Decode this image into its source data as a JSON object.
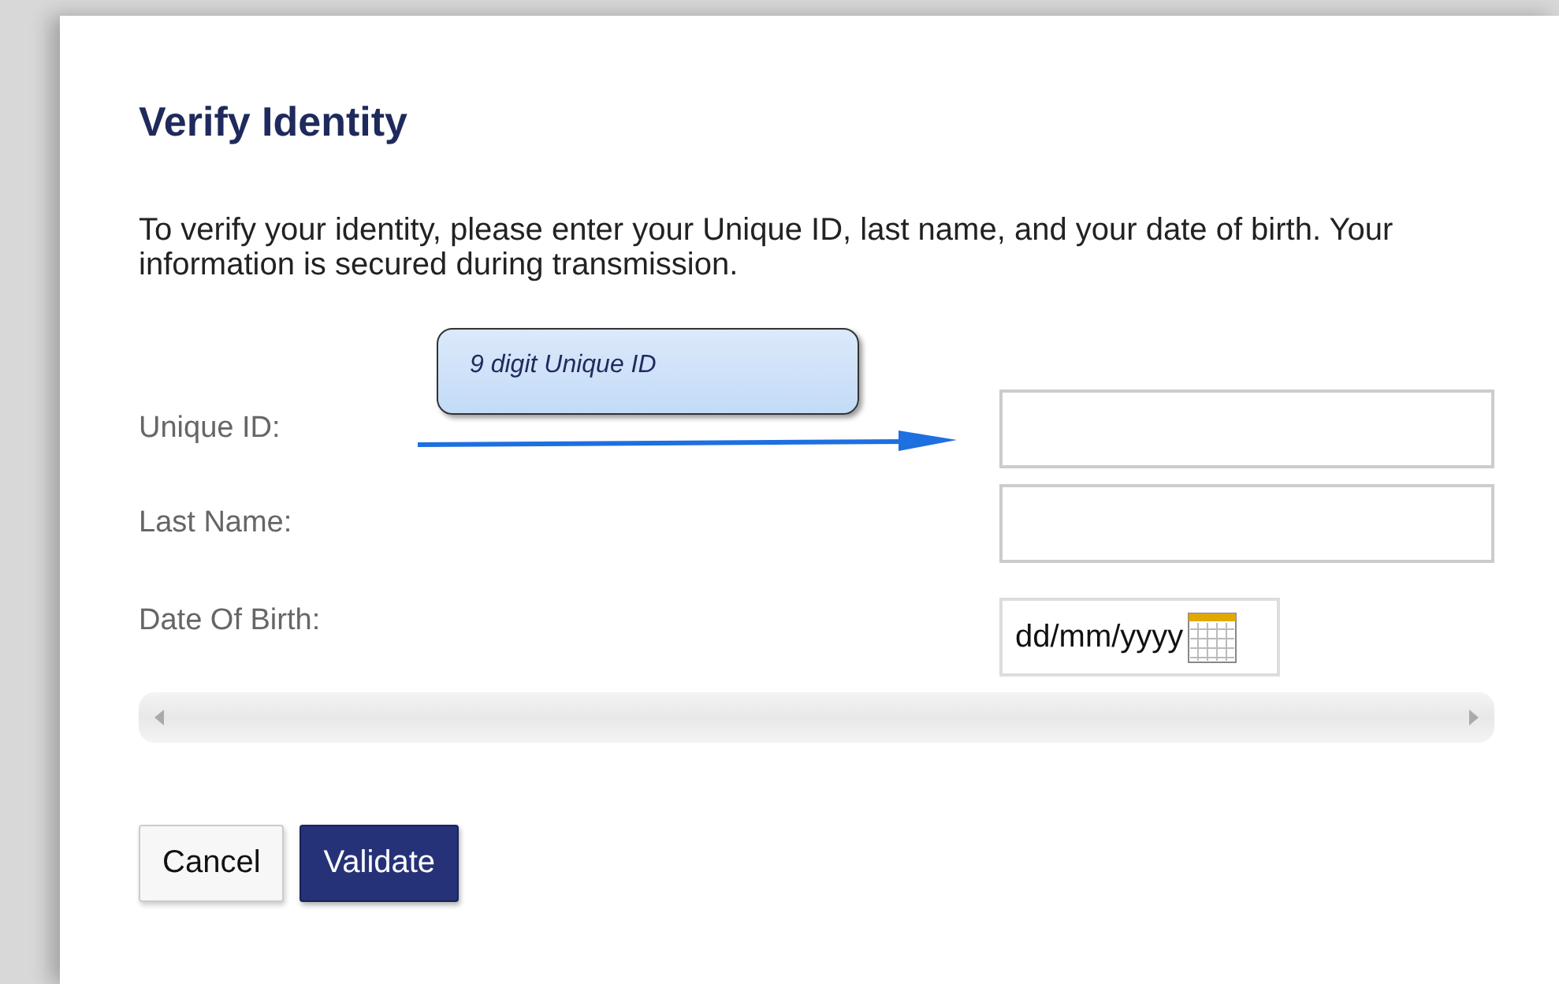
{
  "dialog": {
    "title": "Verify Identity",
    "description": "To verify your identity, please enter your Unique ID, last name, and your date of birth. Your information is secured during transmission."
  },
  "callout": {
    "text": "9 digit Unique ID"
  },
  "fields": [
    {
      "label": "Unique ID:",
      "kind": "text"
    },
    {
      "label": "Last Name:",
      "kind": "text"
    },
    {
      "label": "Date Of Birth:",
      "kind": "date",
      "value": "dd/mm/yyyy"
    }
  ],
  "buttons": [
    {
      "label": "Cancel",
      "kind": "secondary"
    },
    {
      "label": "Validate",
      "kind": "primary"
    }
  ]
}
